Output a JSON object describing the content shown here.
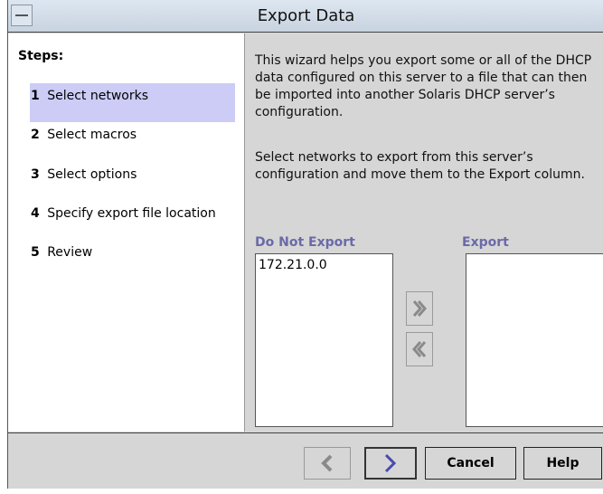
{
  "window": {
    "title": "Export Data"
  },
  "steps": {
    "heading": "Steps:",
    "items": [
      {
        "num": "1",
        "label": "Select networks",
        "active": true
      },
      {
        "num": "2",
        "label": "Select macros",
        "active": false
      },
      {
        "num": "3",
        "label": "Select options",
        "active": false
      },
      {
        "num": "4",
        "label": "Specify export file location",
        "active": false
      },
      {
        "num": "5",
        "label": "Review",
        "active": false
      }
    ]
  },
  "content": {
    "intro": "This wizard helps you export some or all of the DHCP data configured on this server to a file that can then be imported into another Solaris DHCP server’s configuration.",
    "instruction": "Select networks to export from this server’s configuration and move them to the Export column.",
    "do_not_export_label": "Do Not Export",
    "export_label": "Export",
    "do_not_export_items": [
      "172.21.0.0"
    ],
    "export_items": [],
    "move_right_icon": "double-chevron-right-icon",
    "move_left_icon": "double-chevron-left-icon"
  },
  "footer": {
    "back_icon": "back-chevron-icon",
    "next_icon": "next-chevron-icon",
    "cancel_label": "Cancel",
    "help_label": "Help"
  },
  "colors": {
    "active_step_bg": "#ccccf7",
    "list_label": "#6a6aa8",
    "next_arrow": "#4a4ab0",
    "disabled_arrow": "#8a8a8a"
  }
}
